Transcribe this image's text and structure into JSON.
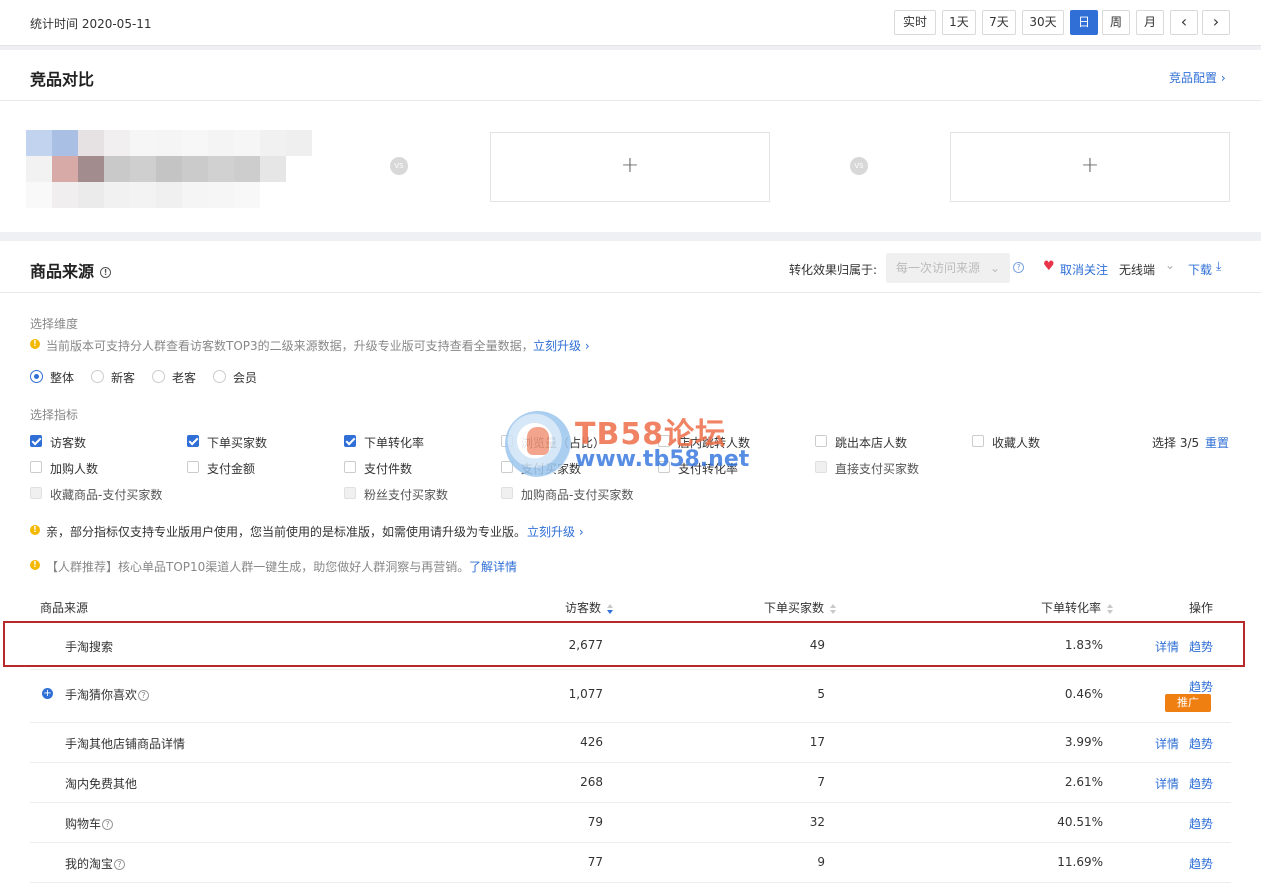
{
  "topbar": {
    "stat_time": "统计时间 2020-05-11",
    "periods": [
      "实时",
      "1天",
      "7天",
      "30天",
      "日",
      "周",
      "月"
    ],
    "active_period": "日",
    "prev": "‹",
    "next": "›"
  },
  "compare": {
    "title": "竞品对比",
    "config_link": "竞品配置 ›",
    "vs_label": "VS",
    "add_label": "+"
  },
  "source": {
    "title": "商品来源",
    "attribution_label": "转化效果归属于:",
    "attribution_value": "每一次访问来源",
    "unfollow": "取消关注",
    "device": "无线端",
    "download": "下载",
    "dimension_label": "选择维度",
    "dimension_tip": "当前版本可支持分人群查看访客数TOP3的二级来源数据，升级专业版可支持查看全量数据，",
    "upgrade_link": "立刻升级 ›",
    "dimensions": [
      "整体",
      "新客",
      "老客",
      "会员"
    ],
    "selected_dimension": "整体",
    "metrics_label": "选择指标",
    "metrics": [
      {
        "label": "访客数",
        "checked": true,
        "disabled": false
      },
      {
        "label": "下单买家数",
        "checked": true,
        "disabled": false
      },
      {
        "label": "下单转化率",
        "checked": true,
        "disabled": false
      },
      {
        "label": "浏览量（占比）",
        "checked": false,
        "disabled": false
      },
      {
        "label": "店内跳转人数",
        "checked": false,
        "disabled": false
      },
      {
        "label": "跳出本店人数",
        "checked": false,
        "disabled": false
      },
      {
        "label": "收藏人数",
        "checked": false,
        "disabled": false
      },
      {
        "label": "加购人数",
        "checked": false,
        "disabled": false
      },
      {
        "label": "支付金额",
        "checked": false,
        "disabled": false
      },
      {
        "label": "支付件数",
        "checked": false,
        "disabled": false
      },
      {
        "label": "支付买家数",
        "checked": false,
        "disabled": false
      },
      {
        "label": "支付转化率",
        "checked": false,
        "disabled": false
      },
      {
        "label": "直接支付买家数",
        "checked": false,
        "disabled": true
      },
      {
        "label": "收藏商品-支付买家数",
        "checked": false,
        "disabled": true
      },
      {
        "label": "粉丝支付买家数",
        "checked": false,
        "disabled": true
      },
      {
        "label": "加购商品-支付买家数",
        "checked": false,
        "disabled": true
      }
    ],
    "select_count": "选择 3/5",
    "reset": "重置",
    "notice_pro": "亲，部分指标仅支持专业版用户使用，您当前使用的是标准版，如需使用请升级为专业版。",
    "notice_pro_link": "立刻升级 ›",
    "notice_crowd": "【人群推荐】核心单品TOP10渠道人群一键生成，助您做好人群洞察与再营销。",
    "notice_crowd_link": "了解详情"
  },
  "table": {
    "headers": {
      "source": "商品来源",
      "visitors": "访客数",
      "buyers": "下单买家数",
      "rate": "下单转化率",
      "ops": "操作"
    },
    "detail": "详情",
    "trend": "趋势",
    "promote": "推广",
    "rows": [
      {
        "name": "手淘搜索",
        "visitors": "2,677",
        "buyers": "49",
        "rate": "1.83%"
      },
      {
        "name": "手淘猜你喜欢",
        "visitors": "1,077",
        "buyers": "5",
        "rate": "0.46%"
      },
      {
        "name": "手淘其他店铺商品详情",
        "visitors": "426",
        "buyers": "17",
        "rate": "3.99%"
      },
      {
        "name": "淘内免费其他",
        "visitors": "268",
        "buyers": "7",
        "rate": "2.61%"
      },
      {
        "name": "购物车",
        "visitors": "79",
        "buyers": "32",
        "rate": "40.51%"
      },
      {
        "name": "我的淘宝",
        "visitors": "77",
        "buyers": "9",
        "rate": "11.69%"
      }
    ]
  },
  "watermark": {
    "title": "TB58论坛",
    "url": "www.tb58.net"
  },
  "colors": {
    "accent": "#2f6fd6",
    "highlight": "#b52a2a",
    "promo": "#f07f12",
    "heart": "#e8334a"
  }
}
